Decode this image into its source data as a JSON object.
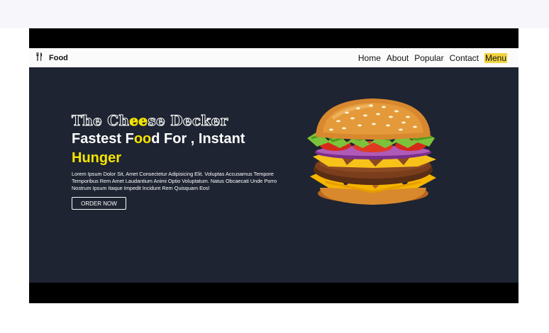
{
  "nav": {
    "brand": "Food",
    "links": [
      "Home",
      "About",
      "Popular",
      "Contact",
      "Menu"
    ],
    "active": "Menu",
    "active_color": "#f2d240"
  },
  "hero": {
    "title_parts": [
      "The Ch",
      "ee",
      "se Decker"
    ],
    "heading_parts": [
      "Fastest F",
      "oo",
      "d For , Instant"
    ],
    "heading2": "Hunger",
    "description": "Lorem Ipsum Dolor Sit, Amet Consectetur Adipisicing Elit. Voluptas Accusamus Tempore Temporibus Rem Amet Laudantium Animi Optio Voluptatum. Natus Obcaecati Unde Porro Nostrum Ipsum Itaque Impedit Incidunt Rem Quisquam Eos!",
    "button": "ORDER NOW",
    "accent_color": "#f5e400",
    "background_color": "#1e2431"
  },
  "icons": {
    "brand": "fork-knife-icon",
    "hero_image": "burger-image"
  }
}
